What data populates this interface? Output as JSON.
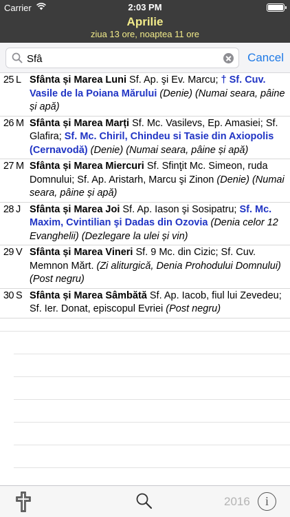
{
  "status_bar": {
    "carrier": "Carrier",
    "time": "2:03 PM"
  },
  "header": {
    "title": "Aprilie",
    "subtitle": "ziua 13 ore, noaptea 11 ore"
  },
  "search": {
    "value": "Sfâ",
    "cancel_label": "Cancel"
  },
  "rows": [
    {
      "day": "25",
      "weekday": "L",
      "segments": [
        {
          "t": "Sfânta și Marea Luni",
          "s": "bold"
        },
        {
          "t": " Sf. Ap. şi Ev. Marcu; ",
          "s": "normal"
        },
        {
          "t": "† Sf. Cuv. Vasile de la Poiana Mărului",
          "s": "blue"
        },
        {
          "t": " (Denie) (Numai seara, pâine și apă)",
          "s": "ital"
        }
      ]
    },
    {
      "day": "26",
      "weekday": "M",
      "segments": [
        {
          "t": "Sfânta și Marea Marți",
          "s": "bold"
        },
        {
          "t": " Sf. Mc. Vasilevs, Ep. Amasiei; Sf. Glafira; ",
          "s": "normal"
        },
        {
          "t": "Sf. Mc. Chiril, Chindeu si Tasie din Axiopolis (Cernavodă)",
          "s": "blue"
        },
        {
          "t": " (Denie) (Numai seara, pâine și apă)",
          "s": "ital"
        }
      ]
    },
    {
      "day": "27",
      "weekday": "M",
      "segments": [
        {
          "t": "Sfânta și Marea Miercuri",
          "s": "bold"
        },
        {
          "t": " Sf. Sfinţit Mc. Simeon, ruda Domnului; Sf. Ap. Aristarh, Marcu şi Zinon ",
          "s": "normal"
        },
        {
          "t": "(Denie) (Numai seara, pâine și apă)",
          "s": "ital"
        }
      ]
    },
    {
      "day": "28",
      "weekday": "J",
      "segments": [
        {
          "t": "Sfânta și Marea Joi",
          "s": "bold"
        },
        {
          "t": " Sf. Ap. Iason şi Sosipatru; ",
          "s": "normal"
        },
        {
          "t": "Sf. Mc. Maxim, Cvintilian şi Dadas din Ozovia",
          "s": "blue"
        },
        {
          "t": " (Denia celor 12 Evanghelii) (Dezlegare la ulei și vin)",
          "s": "ital"
        }
      ]
    },
    {
      "day": "29",
      "weekday": "V",
      "segments": [
        {
          "t": "Sfânta și Marea Vineri",
          "s": "bold"
        },
        {
          "t": " Sf. 9 Mc. din Cizic; Sf. Cuv. Memnon Mărt. ",
          "s": "normal"
        },
        {
          "t": "(Zi aliturgică, Denia Prohodului Domnului) (Post negru)",
          "s": "ital"
        }
      ]
    },
    {
      "day": "30",
      "weekday": "S",
      "segments": [
        {
          "t": "Sfânta și Marea Sâmbătă",
          "s": "bold"
        },
        {
          "t": " Sf. Ap. Iacob, fiul lui Zevedeu; Sf. Ier. Donat, episcopul Evriei ",
          "s": "normal"
        },
        {
          "t": "(Post negru)",
          "s": "ital"
        }
      ]
    }
  ],
  "toolbar": {
    "year": "2016",
    "info_label": "i"
  }
}
